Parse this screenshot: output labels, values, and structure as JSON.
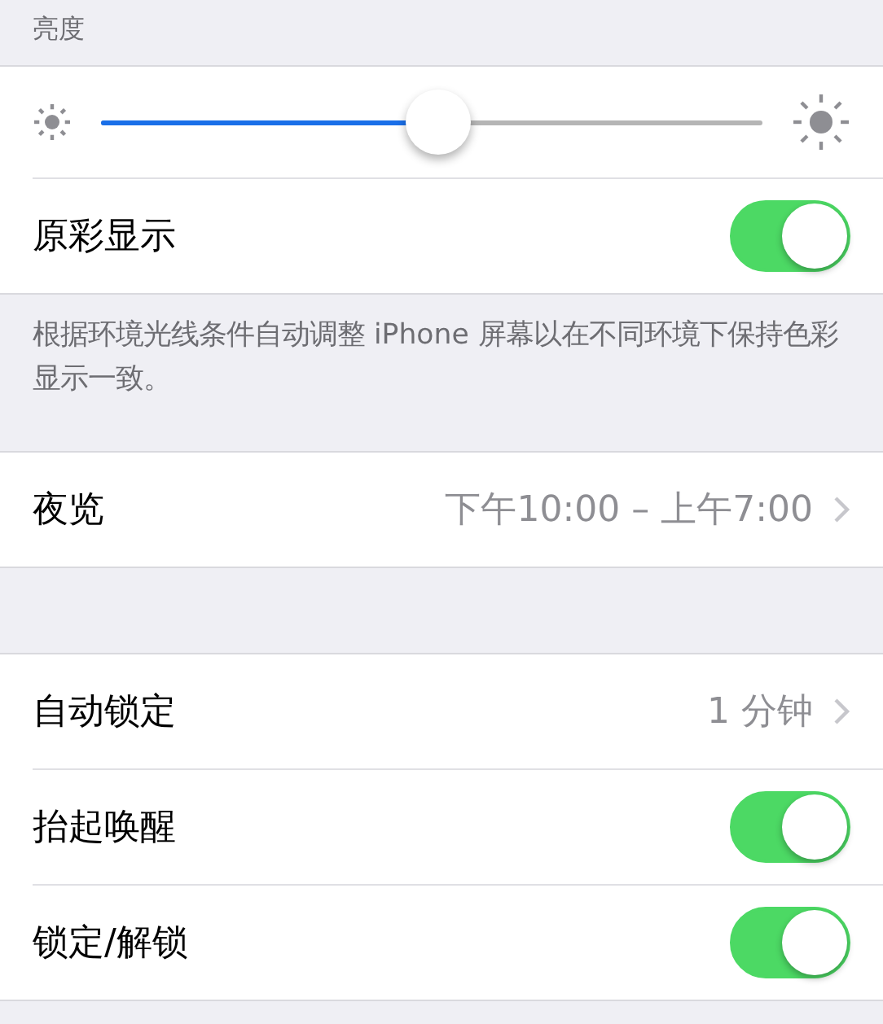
{
  "brightness": {
    "header": "亮度",
    "level": 0.51
  },
  "groups": [
    {
      "rows": [
        {
          "kind": "toggle",
          "label": "原彩显示",
          "on": true
        }
      ],
      "footer": "根据环境光线条件自动调整 iPhone 屏幕以在不同环境下保持色彩显示一致。"
    },
    {
      "rows": [
        {
          "kind": "link",
          "label": "夜览",
          "value": "下午10:00 – 上午7:00"
        }
      ]
    },
    {
      "rows": [
        {
          "kind": "link",
          "label": "自动锁定",
          "value": "1 分钟"
        },
        {
          "kind": "toggle",
          "label": "抬起唤醒",
          "on": true
        },
        {
          "kind": "toggle",
          "label": "锁定/解锁",
          "on": true
        }
      ]
    }
  ]
}
